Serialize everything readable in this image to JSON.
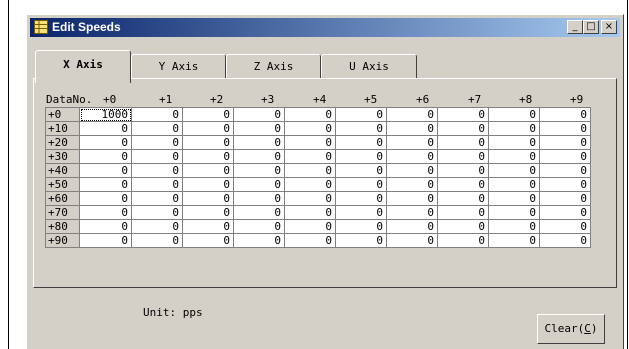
{
  "window": {
    "title": "Edit Speeds",
    "controls": {
      "minimize": "_",
      "maximize": "□",
      "close": "×"
    }
  },
  "tabs": [
    {
      "label": "X Axis",
      "active": true
    },
    {
      "label": "Y Axis",
      "active": false
    },
    {
      "label": "Z Axis",
      "active": false
    },
    {
      "label": "U Axis",
      "active": false
    }
  ],
  "table": {
    "corner_label": "DataNo.",
    "columns": [
      "+0",
      "+1",
      "+2",
      "+3",
      "+4",
      "+5",
      "+6",
      "+7",
      "+8",
      "+9"
    ],
    "rows": [
      {
        "label": "+0",
        "values": [
          "1000",
          "0",
          "0",
          "0",
          "0",
          "0",
          "0",
          "0",
          "0",
          "0"
        ]
      },
      {
        "label": "+10",
        "values": [
          "0",
          "0",
          "0",
          "0",
          "0",
          "0",
          "0",
          "0",
          "0",
          "0"
        ]
      },
      {
        "label": "+20",
        "values": [
          "0",
          "0",
          "0",
          "0",
          "0",
          "0",
          "0",
          "0",
          "0",
          "0"
        ]
      },
      {
        "label": "+30",
        "values": [
          "0",
          "0",
          "0",
          "0",
          "0",
          "0",
          "0",
          "0",
          "0",
          "0"
        ]
      },
      {
        "label": "+40",
        "values": [
          "0",
          "0",
          "0",
          "0",
          "0",
          "0",
          "0",
          "0",
          "0",
          "0"
        ]
      },
      {
        "label": "+50",
        "values": [
          "0",
          "0",
          "0",
          "0",
          "0",
          "0",
          "0",
          "0",
          "0",
          "0"
        ]
      },
      {
        "label": "+60",
        "values": [
          "0",
          "0",
          "0",
          "0",
          "0",
          "0",
          "0",
          "0",
          "0",
          "0"
        ]
      },
      {
        "label": "+70",
        "values": [
          "0",
          "0",
          "0",
          "0",
          "0",
          "0",
          "0",
          "0",
          "0",
          "0"
        ]
      },
      {
        "label": "+80",
        "values": [
          "0",
          "0",
          "0",
          "0",
          "0",
          "0",
          "0",
          "0",
          "0",
          "0"
        ]
      },
      {
        "label": "+90",
        "values": [
          "0",
          "0",
          "0",
          "0",
          "0",
          "0",
          "0",
          "0",
          "0",
          "0"
        ]
      }
    ]
  },
  "unit_text": "Unit: pps",
  "clear_button": {
    "label": "Clear(",
    "accel": "C",
    "suffix": ")"
  },
  "colors": {
    "title_start": "#0a246a",
    "title_end": "#a6caf0",
    "face": "#d4d0c8"
  }
}
